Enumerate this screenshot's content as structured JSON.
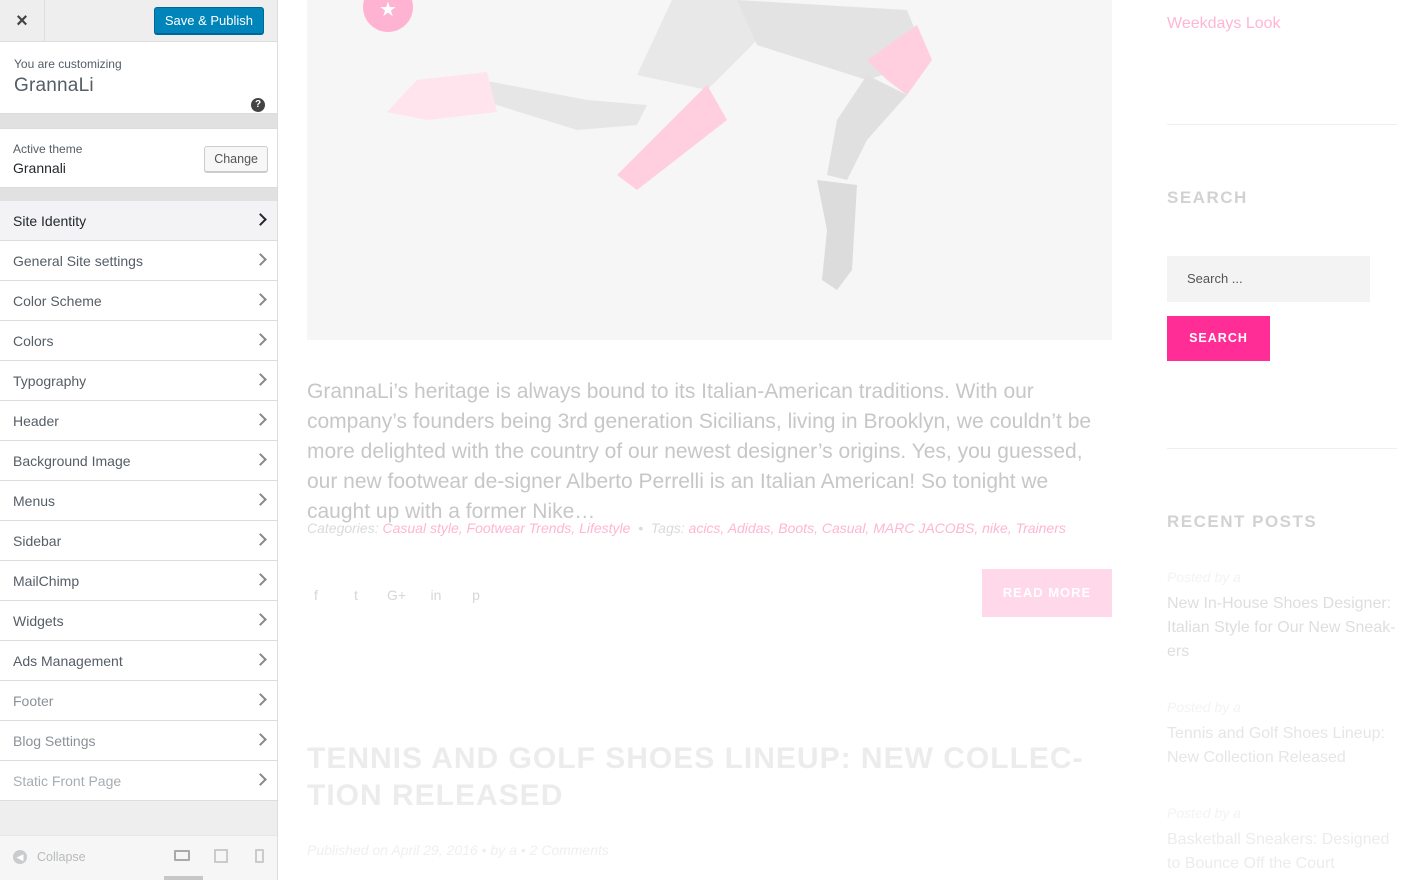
{
  "customizer": {
    "close_icon": "×",
    "save_label": "Save & Publish",
    "customizing_label": "You are customizing",
    "site_name": "GrannaLi",
    "help_icon": "?",
    "active_theme_label": "Active theme",
    "active_theme_name": "Grannali",
    "change_label": "Change",
    "items": [
      {
        "label": "Site Identity"
      },
      {
        "label": "General Site settings"
      },
      {
        "label": "Color Scheme"
      },
      {
        "label": "Colors"
      },
      {
        "label": "Typography"
      },
      {
        "label": "Header"
      },
      {
        "label": "Background Image"
      },
      {
        "label": "Menus"
      },
      {
        "label": "Sidebar"
      },
      {
        "label": "MailChimp"
      },
      {
        "label": "Widgets"
      },
      {
        "label": "Ads Management"
      },
      {
        "label": "Footer"
      },
      {
        "label": "Blog Settings"
      },
      {
        "label": "Static Front Page"
      }
    ],
    "collapse_label": "Collapse"
  },
  "preview": {
    "badge_icon": "★",
    "excerpt": "GrannaLi’s heritage is always bound to its Italian-American traditions. With our company’s founders being 3rd generation Sicilians, living in Brooklyn, we couldn’t be more delighted with the country of our newest designer’s origins. Yes, you guessed, our new footwear de-signer Alberto Perrelli is an Italian American! So tonight we caught up with a former Nike…",
    "categories_label": "Categories:",
    "categories": "Casual style, Footwear Trends, Lifestyle",
    "bullet": "•",
    "tags_label": "Tags:",
    "tags": "acics, Adidas, Boots, Casual, MARC JACOBS, nike, Trainers",
    "share_icons": [
      "f",
      "t",
      "G+",
      "in",
      "p"
    ],
    "read_more": "READ MORE",
    "post2_title": "TENNIS AND GOLF SHOES LINEUP: NEW COLLEC-TION RELEASED",
    "post2_meta": "Published on April 29, 2016  •  by a  •  2 Comments"
  },
  "sidebar_widgets": {
    "weekdays_link": "Weekdays Look",
    "search_title": "SEARCH",
    "search_placeholder": "Search ...",
    "search_button": "SEARCH",
    "recent_title": "RECENT POSTS",
    "recent_posts": [
      {
        "by": "Posted by a",
        "title": "New In-House Shoes Designer: Italian Style for Our New Sneak-ers"
      },
      {
        "by": "Posted by a",
        "title": "Tennis and Golf Shoes Lineup: New Collection Released"
      },
      {
        "by": "Posted by a",
        "title": "Basketball Sneakers: Designed to Bounce Off the Court"
      }
    ]
  },
  "colors": {
    "accent_pink": "#ff2d95",
    "wp_blue": "#0085ba"
  }
}
